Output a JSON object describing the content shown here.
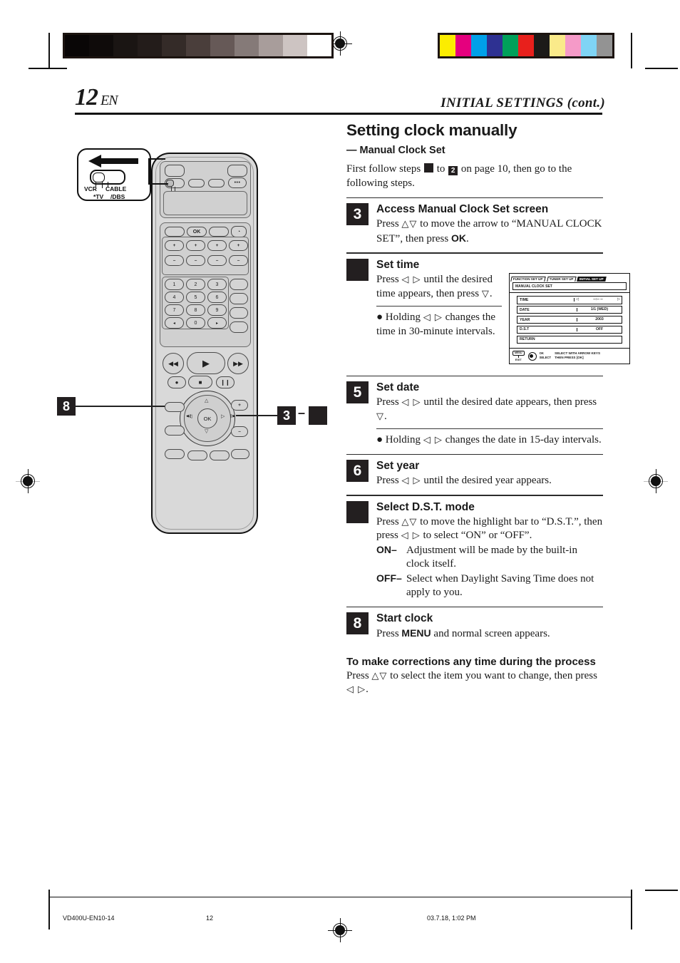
{
  "header": {
    "page_number": "12",
    "page_lang": "EN",
    "running_head": "INITIAL SETTINGS (cont.)"
  },
  "intro": {
    "title": "Setting clock manually",
    "subtitle": "— Manual Clock Set",
    "text_before": "First follow steps",
    "badge_1": "",
    "text_mid": "to",
    "badge_2": "2",
    "text_after": "on page 10, then go to the following steps."
  },
  "steps": [
    {
      "number": "3",
      "heading": "Access Manual Clock Set screen",
      "text": "Press △▽ to move the arrow to “MANUAL CLOCK SET”, then press OK."
    },
    {
      "number": "",
      "heading": "Set time",
      "text": "Press ◁ ▷ until the desired time appears, then press ▽.",
      "bullet": "● Holding ◁ ▷ changes the time in 30-minute intervals."
    },
    {
      "number": "5",
      "heading": "Set date",
      "text": "Press ◁ ▷ until the desired date appears, then press ▽.",
      "bullet": "● Holding ◁ ▷ changes the date in 15-day intervals."
    },
    {
      "number": "6",
      "heading": "Set year",
      "text": "Press ◁ ▷ until the desired year appears."
    },
    {
      "number": "",
      "heading": "Select D.S.T. mode",
      "text": "Press △▽ to move the highlight bar to “D.S.T.”, then press ◁ ▷ to select “ON” or “OFF”.",
      "options": [
        {
          "key": "ON–",
          "desc": "Adjustment will be made by the built-in clock itself."
        },
        {
          "key": "OFF–",
          "desc": "Select when Daylight Saving Time does not apply to you."
        }
      ]
    },
    {
      "number": "8",
      "heading": "Start clock",
      "text": "Press MENU and normal screen appears."
    }
  ],
  "corrections": {
    "heading": "To make corrections any time during the process",
    "text": "Press △▽ to select the item you want to change, then press ◁ ▷."
  },
  "osd": {
    "tabs": [
      {
        "label": "FUNCTION SET UP",
        "active": false
      },
      {
        "label": "TUNER SET UP",
        "active": false
      },
      {
        "label": "INITIAL SET UP",
        "active": true
      }
    ],
    "header_bar": "MANUAL CLOCK SET",
    "rows": [
      {
        "label": "TIME",
        "value": "--:-- --",
        "arrows": true
      },
      {
        "label": "DATE",
        "value": "1/1 (WED)",
        "arrows": false
      },
      {
        "label": "YEAR",
        "value": "2003",
        "arrows": false
      },
      {
        "label": "D.S.T",
        "value": "OFF",
        "arrows": false
      },
      {
        "label": "RETURN",
        "value": "",
        "arrows": false,
        "full": true
      }
    ],
    "legend": {
      "menu_button": "MENU",
      "exit": "EXIT",
      "ok": "OK",
      "select": "SELECT",
      "hint_line1": "SELECT WITH ARROW KEYS",
      "hint_line2": "THEN PRESS [OK]"
    }
  },
  "remote": {
    "balloon": {
      "label_vcr": "VCR",
      "label_cable": "CABLE",
      "label_tv": "*TV",
      "label_dbs": "/DBS"
    },
    "keys": {
      "ok": "OK",
      "plus": "+",
      "minus": "–",
      "num_1": "1",
      "num_2": "2",
      "num_3": "3",
      "num_4": "4",
      "num_5": "5",
      "num_6": "6",
      "num_7": "7",
      "num_8": "8",
      "num_9": "9",
      "num_0": "0",
      "dots": "•••"
    },
    "callouts": [
      {
        "number": "8"
      },
      {
        "number": "3"
      },
      {
        "number": ""
      }
    ],
    "callout_dash": "–"
  },
  "footer": {
    "doc_id": "VD400U-EN10-14",
    "page": "12",
    "timestamp": "03.7.18, 1:02 PM"
  },
  "colors": {
    "gray_bar": [
      "#090606",
      "#0f0b0a",
      "#1a1513",
      "#231c1a",
      "#342b28",
      "#4a3e3b",
      "#665957",
      "#857a78",
      "#a89d9b",
      "#cdc4c2",
      "#ffffff"
    ],
    "color_bar": [
      "#fced00",
      "#e5007e",
      "#00a0e9",
      "#2e3192",
      "#00a05a",
      "#e8201c",
      "#1c1a18",
      "#faea8a",
      "#f59ac8",
      "#7fd4f5",
      "#939393"
    ],
    "ink": "#231f20"
  }
}
